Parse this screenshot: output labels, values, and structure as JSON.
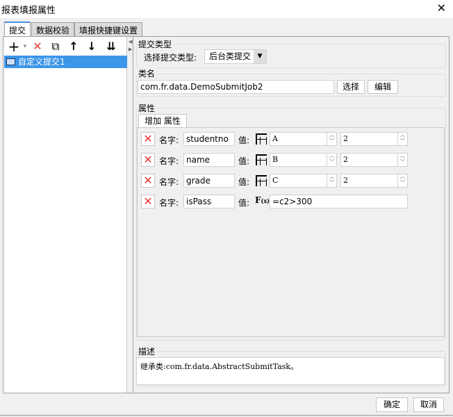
{
  "window": {
    "title": "报表填报属性",
    "close": "✕"
  },
  "tabs": [
    {
      "label": "提交"
    },
    {
      "label": "数据校验"
    },
    {
      "label": "填报快捷键设置"
    }
  ],
  "toolbar": {
    "add": "+",
    "add_menu": "▾",
    "delete": "✕",
    "copy": "⧉",
    "up": "↑",
    "down": "↓",
    "bottom": "⇊"
  },
  "list": {
    "items": [
      {
        "label": "自定义提交1"
      }
    ]
  },
  "submit_type": {
    "group": "提交类型",
    "label": "选择提交类型:",
    "value": "后台类提交"
  },
  "class_name": {
    "group": "类名",
    "value": "com.fr.data.DemoSubmitJob2",
    "select": "选择",
    "edit": "编辑"
  },
  "properties": {
    "group": "属性",
    "add_label": "增加 属性",
    "name_label": "名字:",
    "value_label": "值:",
    "rows": [
      {
        "name": "studentno",
        "type": "cell",
        "col": "A",
        "row": "2"
      },
      {
        "name": "name",
        "type": "cell",
        "col": "B",
        "row": "2"
      },
      {
        "name": "grade",
        "type": "cell",
        "col": "C",
        "row": "2"
      },
      {
        "name": "isPass",
        "type": "formula",
        "formula": "=c2>300"
      }
    ]
  },
  "description": {
    "group": "描述",
    "text": "继承类:com.fr.data.AbstractSubmitTask。"
  },
  "footer": {
    "ok": "确定",
    "cancel": "取消"
  },
  "colors": {
    "delete": "#e53935",
    "selection": "#3d95e8"
  }
}
